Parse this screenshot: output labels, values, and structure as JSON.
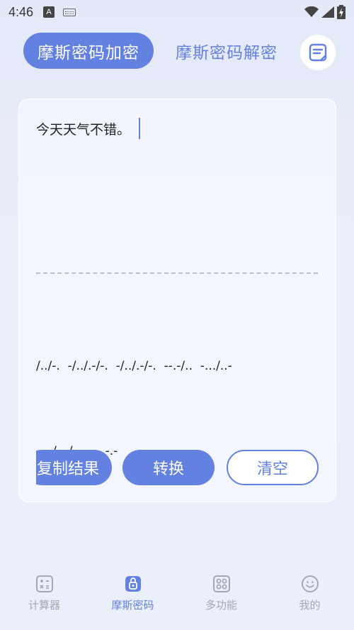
{
  "status_bar": {
    "time": "4:46",
    "a_badge": "A",
    "icons": [
      "keyboard-icon",
      "wifi-icon",
      "signal-icon",
      "battery-icon"
    ]
  },
  "tabs": {
    "encrypt_label": "摩斯密码加密",
    "decrypt_label": "摩斯密码解密"
  },
  "editor": {
    "input_text": "今天天气不错。",
    "output_line1": "/../-.  -/../.-/-.  -/../.-/-.  --.-/..  -.../..-",
    "output_line2": "-.-./..-/---  .-.-.-"
  },
  "buttons": {
    "copy": "复制结果",
    "convert": "转换",
    "clear": "清空"
  },
  "nav": {
    "items": [
      {
        "label": "计算器",
        "icon": "calculator-icon"
      },
      {
        "label": "摩斯密码",
        "icon": "lock-icon"
      },
      {
        "label": "多功能",
        "icon": "grid-icon"
      },
      {
        "label": "我的",
        "icon": "smiley-icon"
      }
    ],
    "active_index": 1
  },
  "colors": {
    "accent": "#6381e0",
    "inactive": "#a3a8b5"
  }
}
